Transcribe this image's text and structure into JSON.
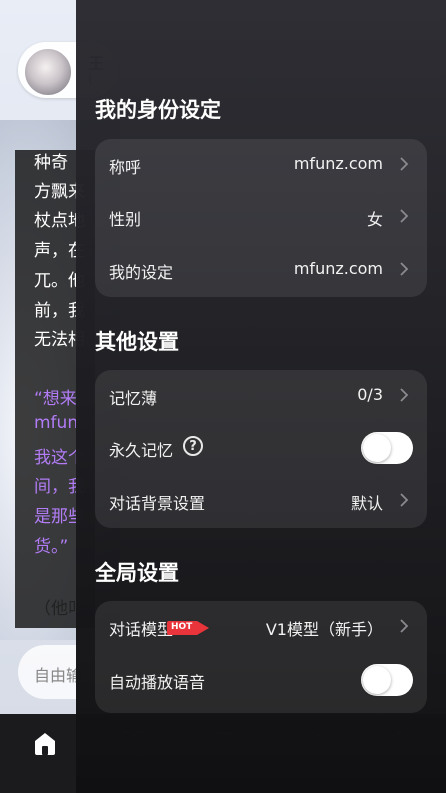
{
  "background": {
    "character_name_fragment": "王",
    "character_sub_fragment": "(",
    "story_lines": [
      {
        "text": "种奇",
        "color": "white"
      },
      {
        "text": "方飘来",
        "color": "white"
      },
      {
        "text": "杖点地",
        "color": "white"
      },
      {
        "text": "声，在",
        "color": "white"
      },
      {
        "text": "兀。他",
        "color": "white"
      },
      {
        "text": "前，我",
        "color": "white"
      },
      {
        "text": "无法相",
        "color": "white"
      },
      {
        "text": "“想来",
        "color": "purple"
      },
      {
        "text": "mfun",
        "color": "purple"
      },
      {
        "text": "我这个",
        "color": "purple"
      },
      {
        "text": "间，我",
        "color": "purple"
      },
      {
        "text": "是那些",
        "color": "purple"
      },
      {
        "text": "货。”",
        "color": "purple"
      }
    ],
    "trailing_text": "（他叫",
    "input_placeholder": "自由输",
    "tabbar": [
      "home-icon",
      "apps-icon",
      "ai-create-icon",
      "chat-icon",
      "profile-icon"
    ]
  },
  "drawer": {
    "identity": {
      "title": "我的身份设定",
      "rows": [
        {
          "label": "称呼",
          "value": "mfunz.com"
        },
        {
          "label": "性别",
          "value": "女"
        },
        {
          "label": "我的设定",
          "value": "mfunz.com"
        }
      ]
    },
    "other": {
      "title": "其他设置",
      "memory_book": {
        "label": "记忆薄",
        "value": "0/3"
      },
      "permanent_memory": {
        "label": "永久记忆",
        "help": "?",
        "enabled": false
      },
      "chat_background": {
        "label": "对话背景设置",
        "value": "默认"
      }
    },
    "global": {
      "title": "全局设置",
      "model": {
        "label": "对话模型",
        "badge": "HOT",
        "value": "V1模型（新手）"
      },
      "autoplay_voice": {
        "label": "自动播放语音",
        "enabled": false
      }
    }
  },
  "colors": {
    "accent_purple": "#b17cf5",
    "hot_badge": "#e8343a"
  }
}
